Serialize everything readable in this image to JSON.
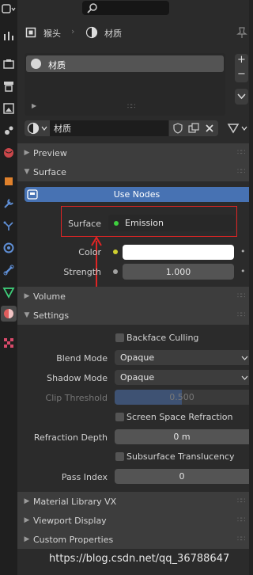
{
  "header": {
    "object_name": "猴头",
    "material_name": "材质"
  },
  "slots": {
    "items": [
      {
        "label": "材质"
      }
    ],
    "add": "+",
    "remove": "−"
  },
  "material_selector": {
    "name": "材质"
  },
  "panels": {
    "preview": "Preview",
    "surface": "Surface",
    "volume": "Volume",
    "settings": "Settings",
    "material_library": "Material Library VX",
    "viewport_display": "Viewport Display",
    "custom_properties": "Custom Properties"
  },
  "surface": {
    "use_nodes_label": "Use Nodes",
    "surface_label": "Surface",
    "surface_value": "Emission",
    "color_label": "Color",
    "color_value": "#ffffff",
    "strength_label": "Strength",
    "strength_value": "1.000"
  },
  "settings": {
    "backface_culling": "Backface Culling",
    "blend_mode_label": "Blend Mode",
    "blend_mode_value": "Opaque",
    "shadow_mode_label": "Shadow Mode",
    "shadow_mode_value": "Opaque",
    "clip_threshold_label": "Clip Threshold",
    "clip_threshold_value": "0.500",
    "ssr": "Screen Space Refraction",
    "refraction_depth_label": "Refraction Depth",
    "refraction_depth_value": "0 m",
    "subsurface": "Subsurface Translucency",
    "pass_index_label": "Pass Index",
    "pass_index_value": "0"
  },
  "watermark": "https://blog.csdn.net/qq_36788647",
  "colors": {
    "accent": "#4772b3",
    "annotation": "#e02424",
    "socket_green": "#3ecf3e",
    "socket_yellow": "#cfcf2f",
    "socket_gray": "#a1a1a1"
  }
}
